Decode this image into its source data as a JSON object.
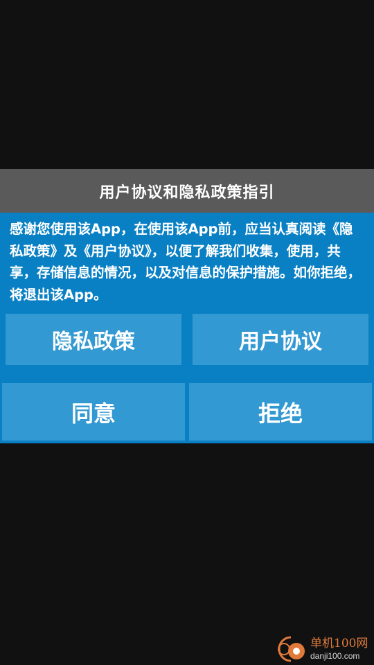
{
  "dialog": {
    "title": "用户协议和隐私政策指引",
    "message": "感谢您使用该App，在使用该App前，应当认真阅读《隐私政策》及《用户协议》，以便了解我们收集，使用，共享，存储信息的情况，以及对信息的保护措施。如你拒绝，将退出该App。",
    "privacy_label": "隐私政策",
    "terms_label": "用户协议",
    "agree_label": "同意",
    "reject_label": "拒绝"
  },
  "watermark": {
    "site_name": "单机100网",
    "site_url": "danji100.com"
  },
  "colors": {
    "background": "#111111",
    "header": "#5a5a5a",
    "dialog": "#0a80c4",
    "button": "#3399d2",
    "watermark_accent": "#e07a3a"
  }
}
